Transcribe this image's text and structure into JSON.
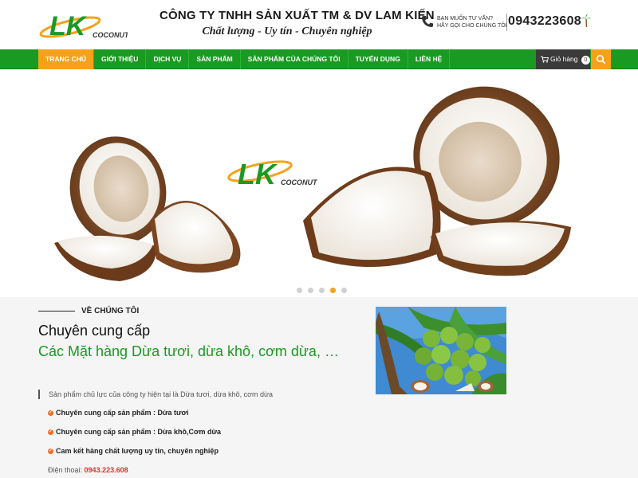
{
  "header": {
    "company_name": "CÔNG TY TNHH SẢN XUẤT TM & DV LAM KIẾN",
    "slogan": "Chất lượng - Uy tín - Chuyên nghiệp",
    "contact_line1": "BẠN MUỐN TƯ VẤN?",
    "contact_line2": "HÃY GỌI CHO CHÚNG TÔI",
    "hotline": "0943223608",
    "logo_letters": "LK",
    "logo_word": "COCONUT"
  },
  "nav": {
    "items": [
      {
        "label": "TRANG CHỦ",
        "active": true
      },
      {
        "label": "GIỚI THIỆU"
      },
      {
        "label": "DỊCH VỤ"
      },
      {
        "label": "SẢN PHẨM"
      },
      {
        "label": "SẢN PHẨM CỦA CHÚNG TÔI"
      },
      {
        "label": "TUYỂN DỤNG"
      },
      {
        "label": "LIÊN HỆ"
      }
    ],
    "cart_label": "Giỏ hàng",
    "cart_count": "0"
  },
  "slider": {
    "logo_letters": "LK",
    "logo_word": "COCONUT",
    "slide_count": 5,
    "active_index": 3
  },
  "about": {
    "section_label": "VỀ CHÚNG TÔI",
    "title": "Chuyên cung cấp",
    "subtitle": "Các Mặt hàng Dừa tươi, dừa khô, cơm dừa, …",
    "intro": "Sản phẩm chủ lực của công ty hiện tại là Dừa tươi, dừa khô, cơm dừa",
    "bullets": [
      "Chuyên cung cấp sản phẩm : Dừa tươi",
      "Chuyên cung cấp sản phẩm : Dừa khô,Cơm dừa",
      "Cam kết hàng chất lượng uy tín, chuyên nghiệp"
    ],
    "phone_label": "Điện thoại:",
    "phone_value": "0943.223.608"
  },
  "colors": {
    "brand_green": "#1a9a22",
    "accent_orange": "#f5a21a",
    "cart_bg": "#3b3b3b"
  }
}
